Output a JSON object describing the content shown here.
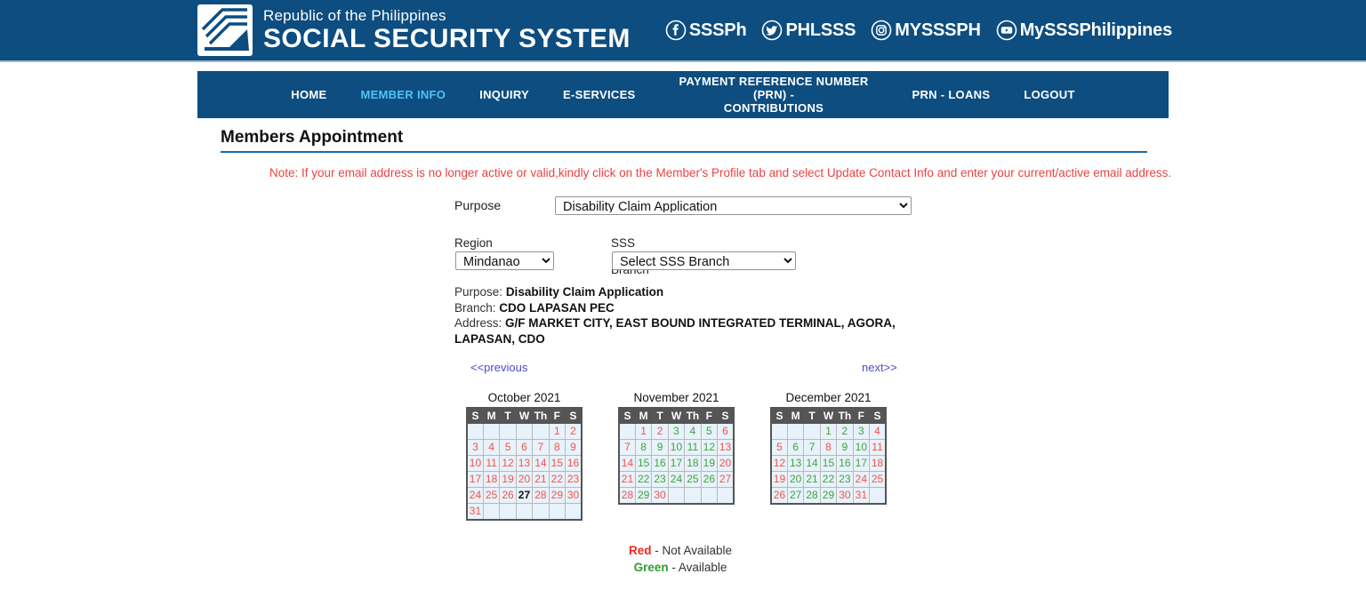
{
  "header": {
    "republic_line": "Republic of the Philippines",
    "org_name": "SOCIAL SECURITY SYSTEM",
    "logo_icon": "sss-logo-icon",
    "socials": [
      {
        "icon": "facebook-icon",
        "handle": "SSSPh"
      },
      {
        "icon": "twitter-icon",
        "handle": "PHLSSS"
      },
      {
        "icon": "instagram-icon",
        "handle": "MYSSSPH"
      },
      {
        "icon": "youtube-icon",
        "handle": "MySSSPhilippines"
      }
    ]
  },
  "nav": {
    "items": [
      {
        "label": "HOME",
        "active": false
      },
      {
        "label": "MEMBER INFO",
        "active": true
      },
      {
        "label": "INQUIRY",
        "active": false
      },
      {
        "label": "E-SERVICES",
        "active": false
      },
      {
        "label": "PAYMENT REFERENCE NUMBER (PRN) -\nCONTRIBUTIONS",
        "active": false
      },
      {
        "label": "PRN - LOANS",
        "active": false
      },
      {
        "label": "LOGOUT",
        "active": false
      }
    ],
    "active_color": "#4fc3f7",
    "bar_color": "#0d4d80"
  },
  "page": {
    "title": "Members Appointment",
    "note": "Note: If your email address is no longer active or valid,kindly click on the Member's Profile tab and select Update Contact Info and enter your current/active email address.",
    "note_color": "#f04040"
  },
  "form": {
    "purpose_label": "Purpose",
    "purpose_value": "Disability Claim Application",
    "region_label": "Region",
    "region_value": "Mindanao",
    "branch_label": "SSS Servicing Branch",
    "branch_value": "Select SSS Branch"
  },
  "details": {
    "purpose_key": "Purpose:",
    "purpose_value": "Disability Claim Application",
    "branch_key": "Branch:",
    "branch_value": "CDO LAPASAN PEC",
    "address_key": "Address:",
    "address_value": "G/F MARKET CITY, EAST BOUND INTEGRATED TERMINAL, AGORA, LAPASAN, CDO"
  },
  "pager": {
    "previous": "<<previous",
    "next": "next>>"
  },
  "calendar": {
    "weekday_headers": [
      "S",
      "M",
      "T",
      "W",
      "Th",
      "F",
      "S"
    ],
    "months": [
      {
        "title": "October 2021",
        "weeks": [
          [
            {
              "d": "",
              "s": "empty"
            },
            {
              "d": "",
              "s": "empty"
            },
            {
              "d": "",
              "s": "empty"
            },
            {
              "d": "",
              "s": "empty"
            },
            {
              "d": "",
              "s": "empty"
            },
            {
              "d": "1",
              "s": "red"
            },
            {
              "d": "2",
              "s": "red"
            }
          ],
          [
            {
              "d": "3",
              "s": "red"
            },
            {
              "d": "4",
              "s": "red"
            },
            {
              "d": "5",
              "s": "red"
            },
            {
              "d": "6",
              "s": "red"
            },
            {
              "d": "7",
              "s": "red"
            },
            {
              "d": "8",
              "s": "red"
            },
            {
              "d": "9",
              "s": "red"
            }
          ],
          [
            {
              "d": "10",
              "s": "red"
            },
            {
              "d": "11",
              "s": "red"
            },
            {
              "d": "12",
              "s": "red"
            },
            {
              "d": "13",
              "s": "red"
            },
            {
              "d": "14",
              "s": "red"
            },
            {
              "d": "15",
              "s": "red"
            },
            {
              "d": "16",
              "s": "red"
            }
          ],
          [
            {
              "d": "17",
              "s": "red"
            },
            {
              "d": "18",
              "s": "red"
            },
            {
              "d": "19",
              "s": "red"
            },
            {
              "d": "20",
              "s": "red"
            },
            {
              "d": "21",
              "s": "red"
            },
            {
              "d": "22",
              "s": "red"
            },
            {
              "d": "23",
              "s": "red"
            }
          ],
          [
            {
              "d": "24",
              "s": "red"
            },
            {
              "d": "25",
              "s": "red"
            },
            {
              "d": "26",
              "s": "red"
            },
            {
              "d": "27",
              "s": "today"
            },
            {
              "d": "28",
              "s": "red"
            },
            {
              "d": "29",
              "s": "red"
            },
            {
              "d": "30",
              "s": "red"
            }
          ],
          [
            {
              "d": "31",
              "s": "red"
            },
            {
              "d": "",
              "s": "empty"
            },
            {
              "d": "",
              "s": "empty"
            },
            {
              "d": "",
              "s": "empty"
            },
            {
              "d": "",
              "s": "empty"
            },
            {
              "d": "",
              "s": "empty"
            },
            {
              "d": "",
              "s": "empty"
            }
          ]
        ]
      },
      {
        "title": "November 2021",
        "weeks": [
          [
            {
              "d": "",
              "s": "empty"
            },
            {
              "d": "1",
              "s": "red"
            },
            {
              "d": "2",
              "s": "red"
            },
            {
              "d": "3",
              "s": "green"
            },
            {
              "d": "4",
              "s": "green"
            },
            {
              "d": "5",
              "s": "green"
            },
            {
              "d": "6",
              "s": "red"
            }
          ],
          [
            {
              "d": "7",
              "s": "red"
            },
            {
              "d": "8",
              "s": "green"
            },
            {
              "d": "9",
              "s": "green"
            },
            {
              "d": "10",
              "s": "green"
            },
            {
              "d": "11",
              "s": "green"
            },
            {
              "d": "12",
              "s": "green"
            },
            {
              "d": "13",
              "s": "red"
            }
          ],
          [
            {
              "d": "14",
              "s": "red"
            },
            {
              "d": "15",
              "s": "green"
            },
            {
              "d": "16",
              "s": "green"
            },
            {
              "d": "17",
              "s": "green"
            },
            {
              "d": "18",
              "s": "green"
            },
            {
              "d": "19",
              "s": "green"
            },
            {
              "d": "20",
              "s": "red"
            }
          ],
          [
            {
              "d": "21",
              "s": "red"
            },
            {
              "d": "22",
              "s": "green"
            },
            {
              "d": "23",
              "s": "green"
            },
            {
              "d": "24",
              "s": "green"
            },
            {
              "d": "25",
              "s": "green"
            },
            {
              "d": "26",
              "s": "green"
            },
            {
              "d": "27",
              "s": "red"
            }
          ],
          [
            {
              "d": "28",
              "s": "red"
            },
            {
              "d": "29",
              "s": "green"
            },
            {
              "d": "30",
              "s": "red"
            },
            {
              "d": "",
              "s": "empty"
            },
            {
              "d": "",
              "s": "empty"
            },
            {
              "d": "",
              "s": "empty"
            },
            {
              "d": "",
              "s": "empty"
            }
          ]
        ]
      },
      {
        "title": "December 2021",
        "weeks": [
          [
            {
              "d": "",
              "s": "empty"
            },
            {
              "d": "",
              "s": "empty"
            },
            {
              "d": "",
              "s": "empty"
            },
            {
              "d": "1",
              "s": "green"
            },
            {
              "d": "2",
              "s": "green"
            },
            {
              "d": "3",
              "s": "green"
            },
            {
              "d": "4",
              "s": "red"
            }
          ],
          [
            {
              "d": "5",
              "s": "red"
            },
            {
              "d": "6",
              "s": "green"
            },
            {
              "d": "7",
              "s": "green"
            },
            {
              "d": "8",
              "s": "red"
            },
            {
              "d": "9",
              "s": "green"
            },
            {
              "d": "10",
              "s": "green"
            },
            {
              "d": "11",
              "s": "red"
            }
          ],
          [
            {
              "d": "12",
              "s": "red"
            },
            {
              "d": "13",
              "s": "green"
            },
            {
              "d": "14",
              "s": "green"
            },
            {
              "d": "15",
              "s": "green"
            },
            {
              "d": "16",
              "s": "green"
            },
            {
              "d": "17",
              "s": "green"
            },
            {
              "d": "18",
              "s": "red"
            }
          ],
          [
            {
              "d": "19",
              "s": "red"
            },
            {
              "d": "20",
              "s": "green"
            },
            {
              "d": "21",
              "s": "green"
            },
            {
              "d": "22",
              "s": "green"
            },
            {
              "d": "23",
              "s": "green"
            },
            {
              "d": "24",
              "s": "red"
            },
            {
              "d": "25",
              "s": "red"
            }
          ],
          [
            {
              "d": "26",
              "s": "red"
            },
            {
              "d": "27",
              "s": "green"
            },
            {
              "d": "28",
              "s": "green"
            },
            {
              "d": "29",
              "s": "green"
            },
            {
              "d": "30",
              "s": "red"
            },
            {
              "d": "31",
              "s": "red"
            },
            {
              "d": "",
              "s": "empty"
            }
          ]
        ]
      }
    ]
  },
  "legend": {
    "red_key": "Red",
    "red_text": " - Not Available",
    "green_key": "Green",
    "green_text": " - Available",
    "red_color": "#f0261a",
    "green_color": "#2f9e2f"
  }
}
